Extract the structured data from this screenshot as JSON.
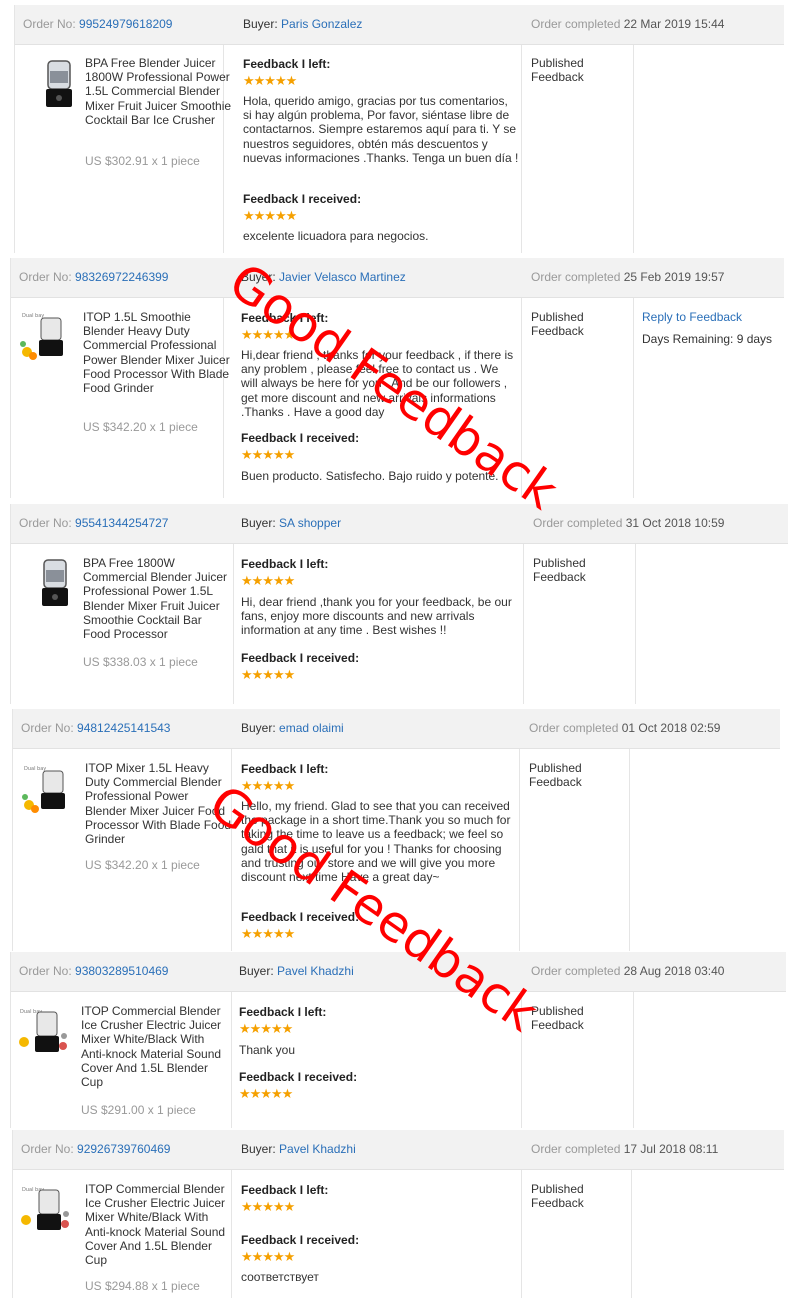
{
  "header_labels": {
    "order_no": "Order No:",
    "buyer": "Buyer:",
    "completed": "Order completed",
    "feedback_left": "Feedback I left:",
    "feedback_received": "Feedback I received:",
    "published": "Published Feedback"
  },
  "star_glyphs": "★★★★★",
  "orders": [
    {
      "order_no": "99524979618209",
      "buyer": "Paris Gonzalez",
      "completed_at": "22 Mar 2019 15:44",
      "product_title": "BPA Free Blender Juicer 1800W Professional Power 1.5L Commercial Blender Mixer Fruit Juicer Smoothie Cocktail Bar Ice Crusher",
      "price": "US $302.91 x 1 piece",
      "feedback_left_rating": 5,
      "feedback_left_text": "Hola, querido amigo, gracias por tus comentarios, si hay algún problema, Por favor, siéntase libre de contactarnos. Siempre estaremos aquí para ti. Y se nuestros seguidores, obtén más descuentos y nuevas informaciones .Thanks. Tenga un buen día !",
      "feedback_received_rating": 5,
      "feedback_received_text": "excelente licuadora para negocios."
    },
    {
      "order_no": "98326972246399",
      "buyer": "Javier Velasco Martinez",
      "completed_at": "25 Feb 2019 19:57",
      "product_title": "ITOP 1.5L Smoothie Blender Heavy Duty Commercial Professional Power Blender Mixer Juicer Food Processor With Blade Food Grinder",
      "price": "US $342.20 x 1 piece",
      "feedback_left_rating": 5,
      "feedback_left_text": "Hi,dear friend , thanks for your feedback , if there is any problem , please feel free to contact us . We will always be here for you . And be our followers , get more discount and new arrivals informations .Thanks . Have a good day",
      "feedback_received_rating": 5,
      "feedback_received_text": "Buen producto. Satisfecho. Bajo ruido y potente.",
      "reply_link": "Reply to Feedback",
      "days_remaining": "Days Remaining: 9 days"
    },
    {
      "order_no": "95541344254727",
      "buyer": "SA shopper",
      "completed_at": "31 Oct 2018 10:59",
      "product_title": "BPA Free 1800W Commercial Blender Juicer Professional Power 1.5L Blender Mixer Fruit Juicer Smoothie Cocktail Bar Food Processor",
      "price": "US $338.03 x 1 piece",
      "feedback_left_rating": 5,
      "feedback_left_text": "Hi, dear friend ,thank you for your feedback, be our fans, enjoy more discounts and new arrivals information at any time . Best wishes !!",
      "feedback_received_rating": 5,
      "feedback_received_text": ""
    },
    {
      "order_no": "94812425141543",
      "buyer": "emad olaimi",
      "completed_at": "01 Oct 2018 02:59",
      "product_title": "ITOP Mixer 1.5L Heavy Duty Commercial Blender Professional Power Blender Mixer Juicer Food Processor With Blade Food Grinder",
      "price": "US $342.20 x 1 piece",
      "feedback_left_rating": 5,
      "feedback_left_text": "Hello, my friend. Glad to see that you can received the package in a short time.Thank you so much for taking the time to leave us a feedback; we feel so gald that it is useful for you ! Thanks for choosing and trusting our store and we will give you more discount next time Have a great day~",
      "feedback_received_rating": 5,
      "feedback_received_text": ""
    },
    {
      "order_no": "93803289510469",
      "buyer": "Pavel Khadzhi",
      "completed_at": "28 Aug 2018 03:40",
      "product_title": "ITOP Commercial Blender Ice Crusher Electric Juicer Mixer White/Black With Anti-knock Material Sound Cover And 1.5L Blender Cup",
      "price": "US $291.00 x 1 piece",
      "feedback_left_rating": 5,
      "feedback_left_text": "Thank you",
      "feedback_received_rating": 5,
      "feedback_received_text": ""
    },
    {
      "order_no": "92926739760469",
      "buyer": "Pavel Khadzhi",
      "completed_at": "17 Jul 2018 08:11",
      "product_title": "ITOP Commercial Blender Ice Crusher Electric Juicer Mixer White/Black With Anti-knock Material Sound Cover And 1.5L Blender Cup",
      "price": "US $294.88 x 1 piece",
      "feedback_left_rating": 5,
      "feedback_left_text": "",
      "feedback_received_rating": 5,
      "feedback_received_text": "соответствует"
    }
  ],
  "watermarks": [
    "Good Feedback",
    "Good Feedback"
  ],
  "colors": {
    "link": "#2a6fb8",
    "star": "#f5a000",
    "watermark": "#ff0000",
    "header_bg": "#f2f2f2"
  }
}
